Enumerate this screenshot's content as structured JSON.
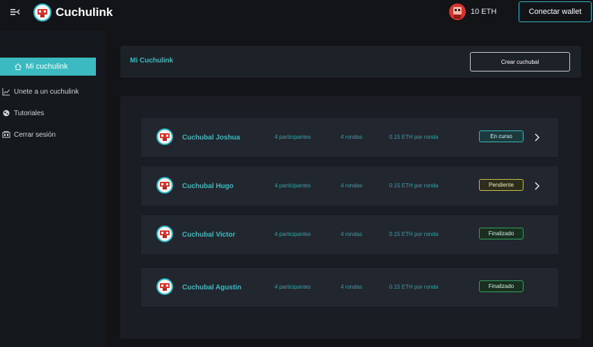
{
  "header": {
    "brand_title": "Cuchulink",
    "eth_balance": "10 ETH",
    "connect_wallet": "Conectar wallet"
  },
  "sidebar": {
    "items": [
      {
        "label": "Mi cuchulink",
        "icon": "home-icon",
        "active": true
      },
      {
        "label": "Unete a un cuchulink",
        "icon": "chart-line-icon",
        "active": false
      },
      {
        "label": "Tutoriales",
        "icon": "tutorial-icon",
        "active": false
      },
      {
        "label": "Cerrar sesión",
        "icon": "logout-icon",
        "active": false
      }
    ]
  },
  "main": {
    "title": "Mi Cuchulink",
    "create_button": "Crear cuchubal",
    "rows": [
      {
        "name": "Cuchubal Joshua",
        "participants": "4 participantes",
        "rounds": "4 rondas",
        "price": "0.15 ETH por ronda",
        "status": "En curso",
        "has_chevron": true
      },
      {
        "name": "Cuchubal Hugo",
        "participants": "4 participantes",
        "rounds": "4 rondas",
        "price": "0.15 ETH por ronda",
        "status": "Pendiente",
        "has_chevron": true
      },
      {
        "name": "Cuchubal Victor",
        "participants": "4 participantes",
        "rounds": "4 rondas",
        "price": "0.15 ETH por ronda",
        "status": "Finalizado",
        "has_chevron": false
      },
      {
        "name": "Cuchubal Agustin",
        "participants": "4 participantes",
        "rounds": "4 rondas",
        "price": "0.15 ETH por ronda",
        "status": "Finalizado",
        "has_chevron": false
      }
    ]
  },
  "colors": {
    "accent": "#3bbac1",
    "background": "#121418",
    "status_en_curso": "#3bbac1",
    "status_pendiente": "#c9c24a",
    "status_finalizado": "#37a35a"
  }
}
